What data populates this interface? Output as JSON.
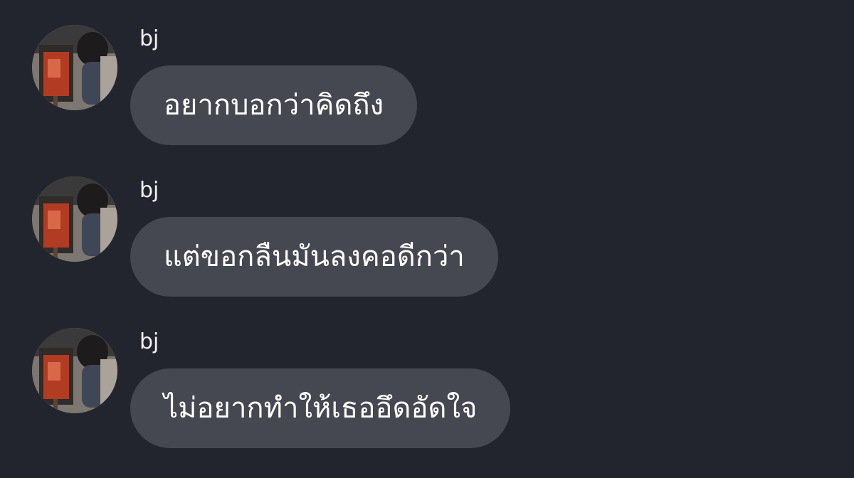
{
  "messages": [
    {
      "sender": "bj",
      "text": "อยากบอกว่าคิดถึง",
      "avatar": "painting-person-avatar"
    },
    {
      "sender": "bj",
      "text": "แต่ขอกลืนมันลงคอดีกว่า",
      "avatar": "painting-person-avatar"
    },
    {
      "sender": "bj",
      "text": "ไม่อยากทำให้เธออึดอัดใจ",
      "avatar": "painting-person-avatar"
    }
  ],
  "colors": {
    "background": "#23252e",
    "bubble": "#454850",
    "text": "#ffffff"
  }
}
